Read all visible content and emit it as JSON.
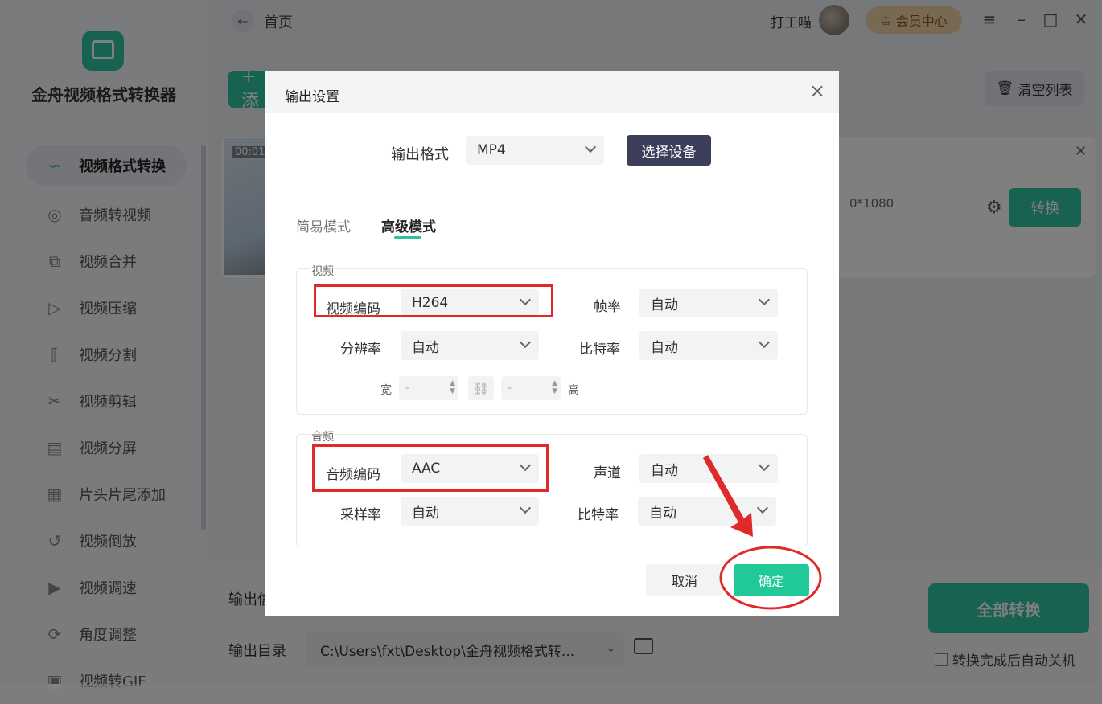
{
  "app": {
    "name": "金舟视频格式转换器",
    "breadcrumb": "首页",
    "user_name": "打工喵",
    "vip_label": "会员中心"
  },
  "sidebar": {
    "items": [
      {
        "label": "视频格式转换",
        "icon": "format-convert-icon",
        "active": true
      },
      {
        "label": "音频转视频",
        "icon": "audio-disc-icon"
      },
      {
        "label": "视频合并",
        "icon": "merge-icon"
      },
      {
        "label": "视频压缩",
        "icon": "compress-icon"
      },
      {
        "label": "视频分割",
        "icon": "split-icon"
      },
      {
        "label": "视频剪辑",
        "icon": "scissors-icon"
      },
      {
        "label": "视频分屏",
        "icon": "split-screen-icon"
      },
      {
        "label": "片头片尾添加",
        "icon": "film-strip-icon"
      },
      {
        "label": "视频倒放",
        "icon": "reverse-icon"
      },
      {
        "label": "视频调速",
        "icon": "speed-icon"
      },
      {
        "label": "角度调整",
        "icon": "rotate-icon"
      },
      {
        "label": "视频转GIF",
        "icon": "gif-icon"
      }
    ]
  },
  "main": {
    "add_label": "+ 添",
    "clear_label": "清空列表",
    "file": {
      "time": "00:01",
      "resolution_fragment": "0*1080",
      "convert_label": "转换"
    },
    "output_label_1": "输出信",
    "output_dir_label": "输出目录",
    "output_dir_value": "C:\\Users\\fxt\\Desktop\\金舟视频格式转...",
    "convert_all_label": "全部转换",
    "auto_shutdown_label": "转换完成后自动关机"
  },
  "dialog": {
    "title": "输出设置",
    "format_label": "输出格式",
    "format_value": "MP4",
    "choose_device_label": "选择设备",
    "tabs": [
      {
        "label": "简易模式",
        "active": false
      },
      {
        "label": "高级模式",
        "active": true
      }
    ],
    "video_group": {
      "title": "视频",
      "codec_label": "视频编码",
      "codec_value": "H264",
      "fps_label": "帧率",
      "fps_value": "自动",
      "resolution_label": "分辨率",
      "resolution_value": "自动",
      "bitrate_label": "比特率",
      "bitrate_value": "自动",
      "width_label": "宽",
      "width_value": "-",
      "height_label": "高",
      "height_value": "-"
    },
    "audio_group": {
      "title": "音频",
      "codec_label": "音频编码",
      "codec_value": "AAC",
      "channel_label": "声道",
      "channel_value": "自动",
      "samplerate_label": "采样率",
      "samplerate_value": "自动",
      "bitrate_label": "比特率",
      "bitrate_value": "自动"
    },
    "cancel_label": "取消",
    "ok_label": "确定"
  },
  "colors": {
    "accent": "#2ec4a0",
    "annotation": "#e02a2a",
    "device_button": "#3d3f5a"
  }
}
